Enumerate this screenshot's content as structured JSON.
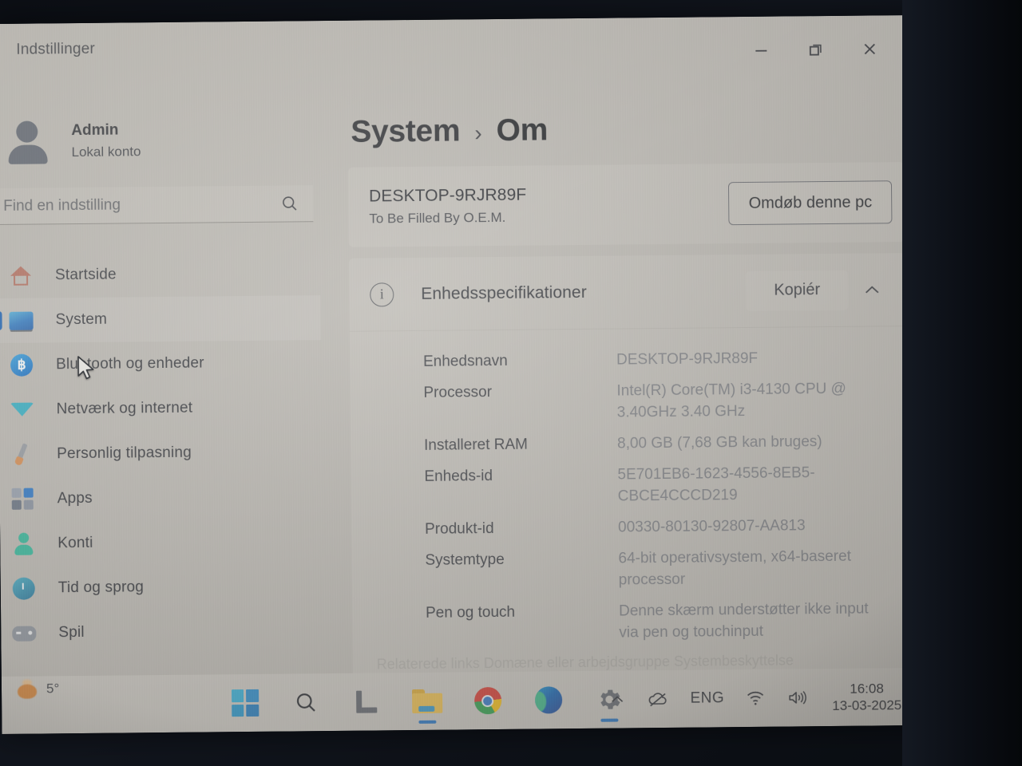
{
  "window": {
    "app_title": "Indstillinger",
    "controls": {
      "minimize": "minimize-icon",
      "restore": "restore-icon",
      "close": "close-icon"
    }
  },
  "sidebar": {
    "account": {
      "name": "Admin",
      "type": "Lokal konto",
      "avatar_icon": "user-avatar-icon"
    },
    "search": {
      "placeholder": "Find en indstilling",
      "icon": "search-icon"
    },
    "items": [
      {
        "label": "Startside",
        "icon": "home-icon",
        "selected": false
      },
      {
        "label": "System",
        "icon": "monitor-icon",
        "selected": true
      },
      {
        "label": "Bluetooth og enheder",
        "icon": "bluetooth-icon",
        "selected": false
      },
      {
        "label": "Netværk og internet",
        "icon": "wifi-icon",
        "selected": false
      },
      {
        "label": "Personlig tilpasning",
        "icon": "brush-icon",
        "selected": false
      },
      {
        "label": "Apps",
        "icon": "apps-icon",
        "selected": false
      },
      {
        "label": "Konti",
        "icon": "account-icon",
        "selected": false
      },
      {
        "label": "Tid og sprog",
        "icon": "clock-globe-icon",
        "selected": false
      },
      {
        "label": "Spil",
        "icon": "gamepad-icon",
        "selected": false
      }
    ]
  },
  "main": {
    "breadcrumb": {
      "root": "System",
      "separator": "›",
      "leaf": "Om"
    },
    "pc_card": {
      "name": "DESKTOP-9RJR89F",
      "oem": "To Be Filled By O.E.M.",
      "rename_button": "Omdøb denne pc"
    },
    "specs": {
      "icon": "info-icon",
      "title": "Enhedsspecifikationer",
      "copy_button": "Kopiér",
      "collapse_icon": "chevron-up-icon",
      "rows": [
        {
          "label": "Enhedsnavn",
          "value": "DESKTOP-9RJR89F"
        },
        {
          "label": "Processor",
          "value": "Intel(R) Core(TM) i3-4130 CPU @ 3.40GHz   3.40 GHz"
        },
        {
          "label": "Installeret RAM",
          "value": "8,00 GB (7,68 GB kan bruges)"
        },
        {
          "label": "Enheds-id",
          "value": "5E701EB6-1623-4556-8EB5-CBCE4CCCD219"
        },
        {
          "label": "Produkt-id",
          "value": "00330-80130-92807-AA813"
        },
        {
          "label": "Systemtype",
          "value": "64-bit operativsystem, x64-baseret processor"
        },
        {
          "label": "Pen og touch",
          "value": "Denne skærm understøtter ikke input via pen og touchinput"
        }
      ],
      "related_clipped": "Relaterede links   Domæne eller arbejdsgruppe   Systembeskyttelse"
    }
  },
  "taskbar": {
    "weather": {
      "temperature": "5°",
      "icon": "sun-icon"
    },
    "buttons": [
      {
        "name": "start-button",
        "icon": "windows-logo-icon",
        "active": false
      },
      {
        "name": "search-button",
        "icon": "search-icon",
        "active": false
      },
      {
        "name": "task-view-button",
        "icon": "task-view-icon",
        "active": false
      },
      {
        "name": "file-explorer-button",
        "icon": "folder-icon",
        "active": true
      },
      {
        "name": "chrome-button",
        "icon": "chrome-icon",
        "active": false
      },
      {
        "name": "edge-button",
        "icon": "edge-icon",
        "active": false
      },
      {
        "name": "settings-button",
        "icon": "gear-icon",
        "active": true
      }
    ],
    "tray": {
      "overflow_icon": "chevron-up-icon",
      "onedrive_icon": "cloud-offline-icon",
      "language": "ENG",
      "wifi_icon": "wifi-icon",
      "volume_icon": "speaker-icon",
      "time": "16:08",
      "date": "13-03-2025",
      "notifications_icon": "bell-icon"
    }
  },
  "colors": {
    "accent": "#1668c8",
    "window_bg": "#bfbcb6",
    "card_bg": "#c5c2bc",
    "taskbar_bg": "#cbc8c2",
    "text_primary": "#2e3138",
    "text_secondary": "#82858c",
    "bezel": "#0a0d13"
  }
}
